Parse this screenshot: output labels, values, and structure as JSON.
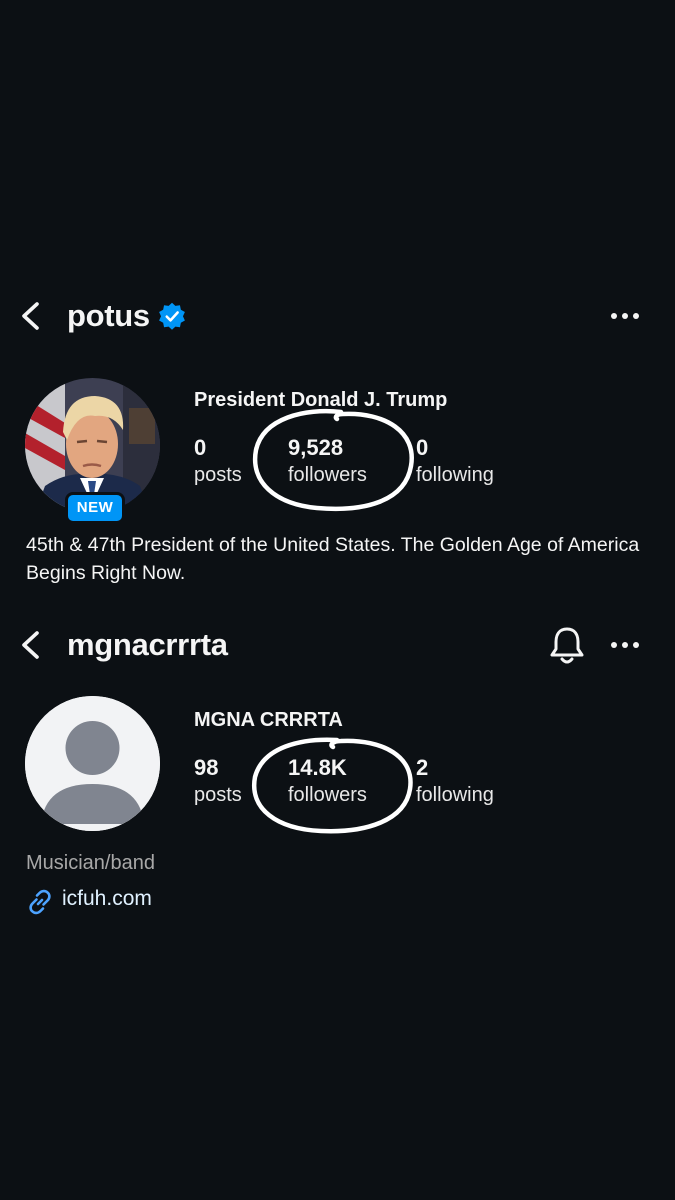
{
  "profiles": [
    {
      "username": "potus",
      "verified": true,
      "display_name": "President Donald J. Trump",
      "avatar_badge": "NEW",
      "stats": {
        "posts_value": "0",
        "posts_label": "posts",
        "followers_value": "9,528",
        "followers_label": "followers",
        "following_value": "0",
        "following_label": "following"
      },
      "bio": "45th & 47th President of the United States. The Golden Age of America Begins Right Now."
    },
    {
      "username": "mgnacrrrta",
      "verified": false,
      "display_name": "MGNA CRRRTA",
      "stats": {
        "posts_value": "98",
        "posts_label": "posts",
        "followers_value": "14.8K",
        "followers_label": "followers",
        "following_value": "2",
        "following_label": "following"
      },
      "category": "Musician/band",
      "link": "icfuh.com"
    }
  ],
  "icons": {
    "back": "chevron-left-icon",
    "verified": "verified-badge-icon",
    "more": "more-horizontal-icon",
    "notifications": "bell-icon",
    "link": "link-icon",
    "default_avatar": "default-avatar-icon"
  },
  "colors": {
    "background": "#0c1014",
    "text": "#f5f5f5",
    "secondary_text": "#a8a8a8",
    "verified_blue": "#0095f6",
    "link_text": "#e0f1ff",
    "annotation": "#ffffff"
  }
}
